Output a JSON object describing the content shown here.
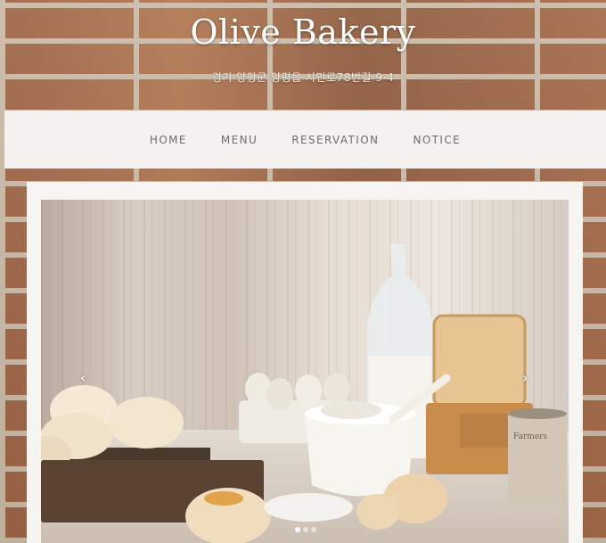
{
  "header": {
    "title": "Olive Bakery",
    "address": "경기 양평군 양평읍 시민로78번길 9-4"
  },
  "nav": {
    "items": [
      {
        "label": "HOME"
      },
      {
        "label": "MENU"
      },
      {
        "label": "RESERVATION"
      },
      {
        "label": "NOTICE"
      }
    ]
  },
  "slider": {
    "prev_label": "‹",
    "next_label": "›",
    "slide_count": 3,
    "active_index": 0
  }
}
